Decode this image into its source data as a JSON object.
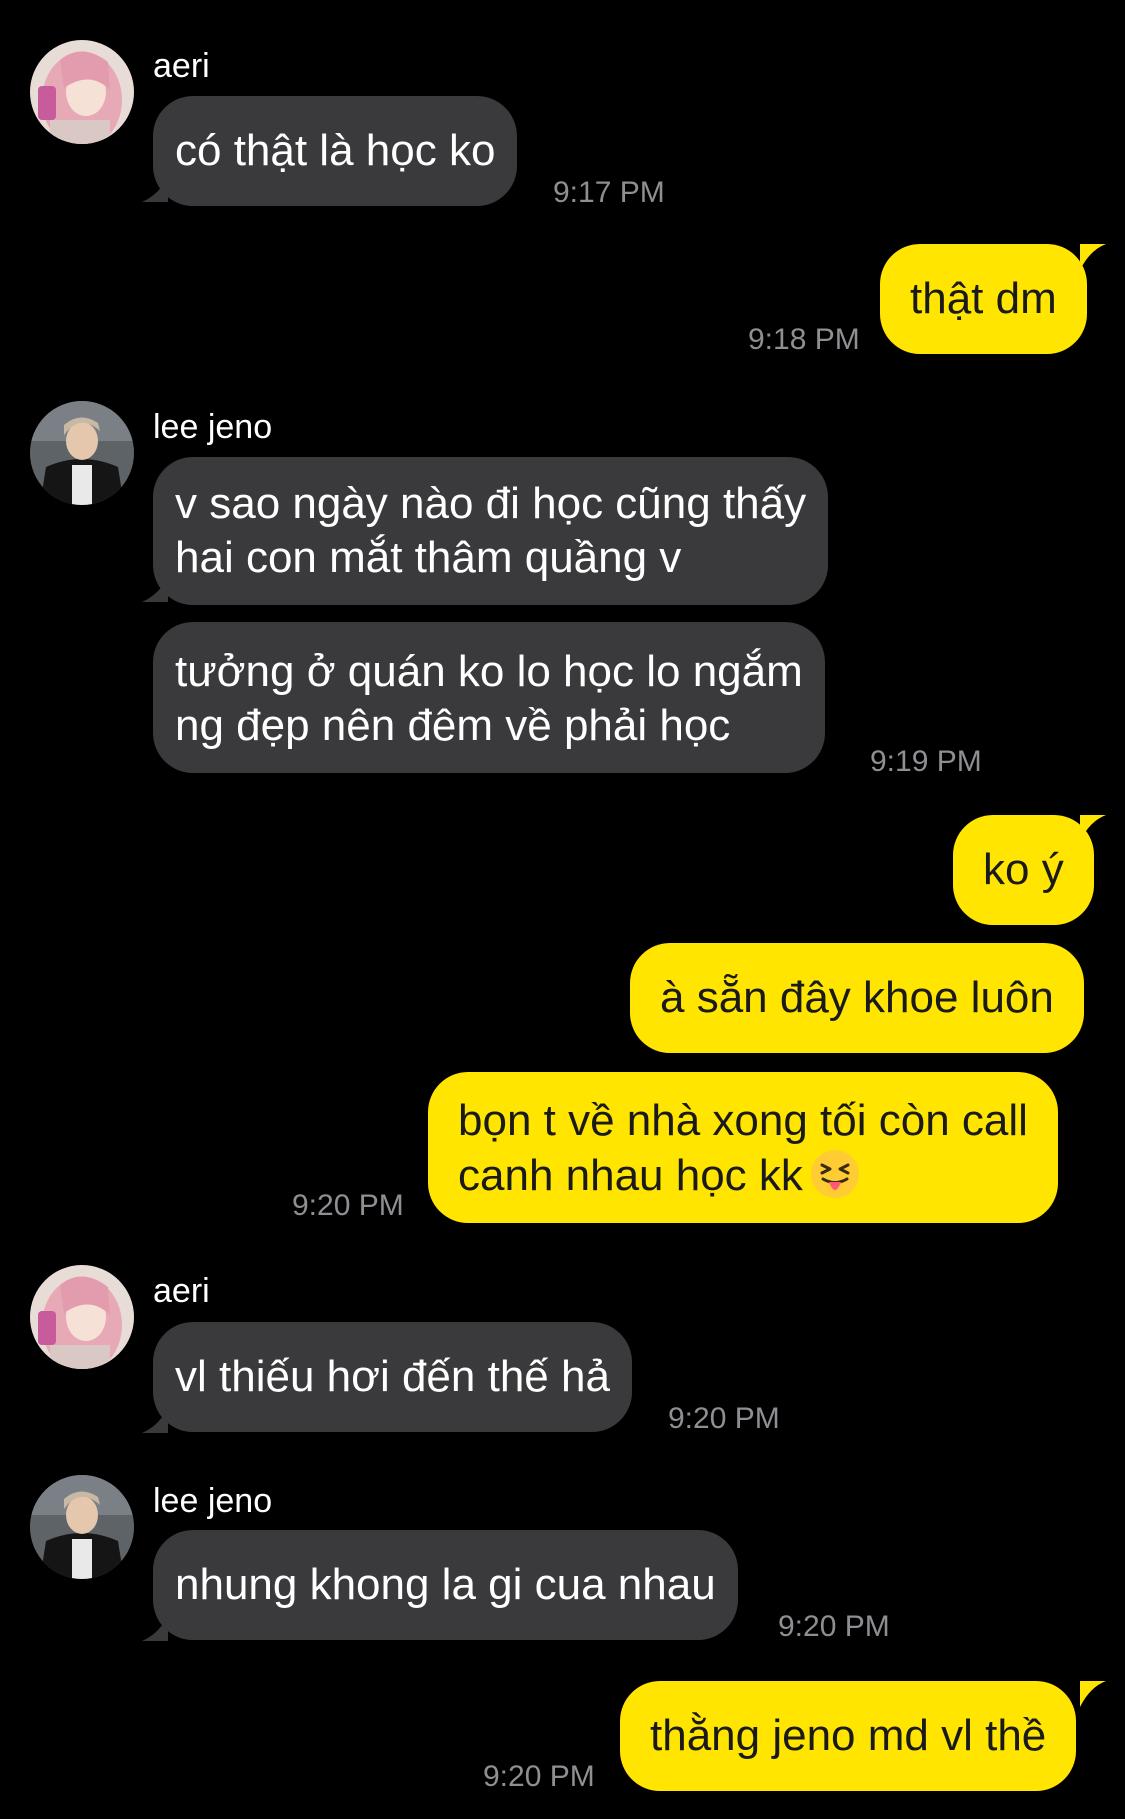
{
  "colors": {
    "background": "#000000",
    "incoming_bubble": "#3a3a3c",
    "outgoing_bubble": "#ffe500",
    "timestamp": "#8e8e93"
  },
  "messages": [
    {
      "sender": "aeri",
      "avatar": "aeri-avatar-icon",
      "direction": "in",
      "lines": [
        "có thật là học ko"
      ],
      "time": "9:17 PM"
    },
    {
      "direction": "out",
      "lines": [
        "thật dm"
      ],
      "time": "9:18 PM"
    },
    {
      "sender": "lee jeno",
      "avatar": "jeno-avatar-icon",
      "direction": "in",
      "lines": [
        "v sao ngày nào đi học cũng thấy",
        "hai con mắt thâm quầng v"
      ]
    },
    {
      "direction": "in",
      "lines": [
        "tưởng ở quán ko lo học lo ngắm",
        "ng đẹp nên đêm về phải học"
      ],
      "time": "9:19 PM"
    },
    {
      "direction": "out",
      "lines": [
        "ko ý"
      ]
    },
    {
      "direction": "out",
      "lines": [
        "à sẵn đây khoe luôn"
      ]
    },
    {
      "direction": "out",
      "lines": [
        "bọn t về nhà xong tối còn call",
        "canh nhau học kk"
      ],
      "emoji": "squinting-tongue-emoji",
      "time": "9:20 PM"
    },
    {
      "sender": "aeri",
      "avatar": "aeri-avatar-icon",
      "direction": "in",
      "lines": [
        "vl thiếu hơi đến thế hả"
      ],
      "time": "9:20 PM"
    },
    {
      "sender": "lee jeno",
      "avatar": "jeno-avatar-icon",
      "direction": "in",
      "lines": [
        "nhung khong la gi cua nhau"
      ],
      "time": "9:20 PM"
    },
    {
      "direction": "out",
      "lines": [
        "thằng jeno md vl thề"
      ],
      "time": "9:20 PM"
    }
  ]
}
